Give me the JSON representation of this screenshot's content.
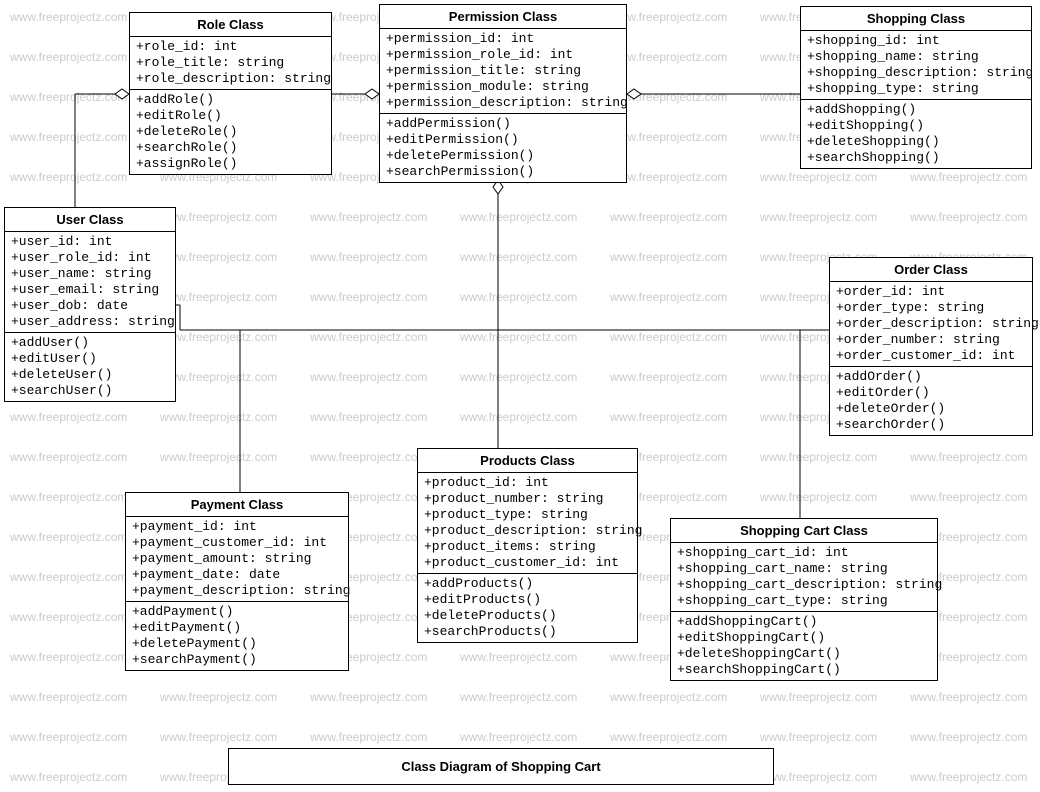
{
  "watermark_text": "www.freeprojectz.com",
  "caption": "Class Diagram of Shopping Cart",
  "classes": {
    "role": {
      "title": "Role Class",
      "attrs": [
        "+role_id: int",
        "+role_title: string",
        "+role_description: string"
      ],
      "ops": [
        "+addRole()",
        "+editRole()",
        "+deleteRole()",
        "+searchRole()",
        "+assignRole()"
      ]
    },
    "permission": {
      "title": "Permission Class",
      "attrs": [
        "+permission_id: int",
        "+permission_role_id: int",
        "+permission_title: string",
        "+permission_module: string",
        "+permission_description: string"
      ],
      "ops": [
        "+addPermission()",
        "+editPermission()",
        "+deletePermission()",
        "+searchPermission()"
      ]
    },
    "shopping": {
      "title": "Shopping Class",
      "attrs": [
        "+shopping_id: int",
        "+shopping_name: string",
        "+shopping_description: string",
        "+shopping_type: string"
      ],
      "ops": [
        "+addShopping()",
        "+editShopping()",
        "+deleteShopping()",
        "+searchShopping()"
      ]
    },
    "user": {
      "title": "User Class",
      "attrs": [
        "+user_id: int",
        "+user_role_id: int",
        "+user_name: string",
        "+user_email: string",
        "+user_dob: date",
        "+user_address: string"
      ],
      "ops": [
        "+addUser()",
        "+editUser()",
        "+deleteUser()",
        "+searchUser()"
      ]
    },
    "order": {
      "title": "Order Class",
      "attrs": [
        "+order_id: int",
        "+order_type: string",
        "+order_description: string",
        "+order_number: string",
        "+order_customer_id: int"
      ],
      "ops": [
        "+addOrder()",
        "+editOrder()",
        "+deleteOrder()",
        "+searchOrder()"
      ]
    },
    "products": {
      "title": "Products  Class",
      "attrs": [
        "+product_id: int",
        "+product_number: string",
        "+product_type: string",
        "+product_description: string",
        "+product_items: string",
        "+product_customer_id: int"
      ],
      "ops": [
        "+addProducts()",
        "+editProducts()",
        "+deleteProducts()",
        "+searchProducts()"
      ]
    },
    "payment": {
      "title": "Payment Class",
      "attrs": [
        "+payment_id: int",
        "+payment_customer_id: int",
        "+payment_amount: string",
        "+payment_date: date",
        "+payment_description: string"
      ],
      "ops": [
        "+addPayment()",
        "+editPayment()",
        "+deletePayment()",
        "+searchPayment()"
      ]
    },
    "cart": {
      "title": "Shopping Cart Class",
      "attrs": [
        "+shopping_cart_id: int",
        "+shopping_cart_name: string",
        "+shopping_cart_description: string",
        "+shopping_cart_type: string"
      ],
      "ops": [
        "+addShoppingCart()",
        "+editShoppingCart()",
        "+deleteShoppingCart()",
        "+searchShoppingCart()"
      ]
    }
  }
}
